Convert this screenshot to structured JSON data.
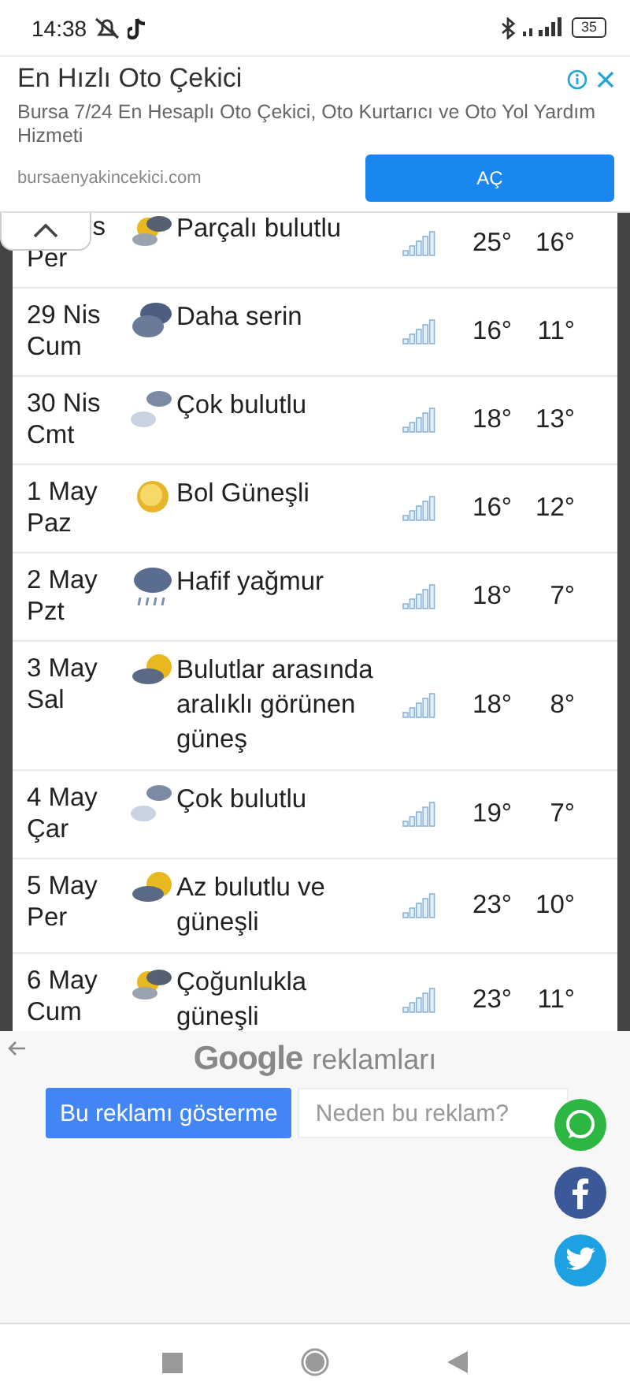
{
  "status_bar": {
    "time": "14:38",
    "battery": "35"
  },
  "ad": {
    "title": "En Hızlı Oto Çekici",
    "description": "Bursa 7/24 En Hesaplı Oto Çekici, Oto Kurtarıcı ve Oto Yol Yardım Hizmeti",
    "url": "bursaenyakincekici.com",
    "button": "AÇ"
  },
  "forecast": {
    "rows": [
      {
        "date": "s",
        "day": "Per",
        "kind": "sun_dark_cloud",
        "description": "Parçalı bulutlu",
        "max": "25°",
        "min": "16°"
      },
      {
        "date": "29 Nis",
        "day": "Cum",
        "kind": "dark_clouds",
        "description": "Daha serin",
        "max": "16°",
        "min": "11°"
      },
      {
        "date": "30 Nis",
        "day": "Cmt",
        "kind": "two_clouds",
        "description": "Çok bulutlu",
        "max": "18°",
        "min": "13°"
      },
      {
        "date": "1 May",
        "day": "Paz",
        "kind": "sun",
        "description": "Bol Güneşli",
        "max": "16°",
        "min": "12°"
      },
      {
        "date": "2 May",
        "day": "Pzt",
        "kind": "rain",
        "description": "Hafif yağmur",
        "max": "18°",
        "min": "7°"
      },
      {
        "date": "3 May",
        "day": "Sal",
        "kind": "sun_cloud",
        "description": "Bulutlar arasında aralıklı görünen güneş",
        "max": "18°",
        "min": "8°"
      },
      {
        "date": "4 May",
        "day": "Çar",
        "kind": "two_clouds",
        "description": "Çok bulutlu",
        "max": "19°",
        "min": "7°"
      },
      {
        "date": "5 May",
        "day": "Per",
        "kind": "sun_cloud",
        "description": "Az bulutlu ve güneşli",
        "max": "23°",
        "min": "10°"
      },
      {
        "date": "6 May",
        "day": "Cum",
        "kind": "sun_dark_cloud",
        "description": "Çoğunlukla güneşli",
        "max": "23°",
        "min": "11°"
      }
    ]
  },
  "google_ads": {
    "logo": "Google",
    "label": "reklamları",
    "hide_button": "Bu reklamı gösterme",
    "why_button": "Neden bu reklam?"
  }
}
